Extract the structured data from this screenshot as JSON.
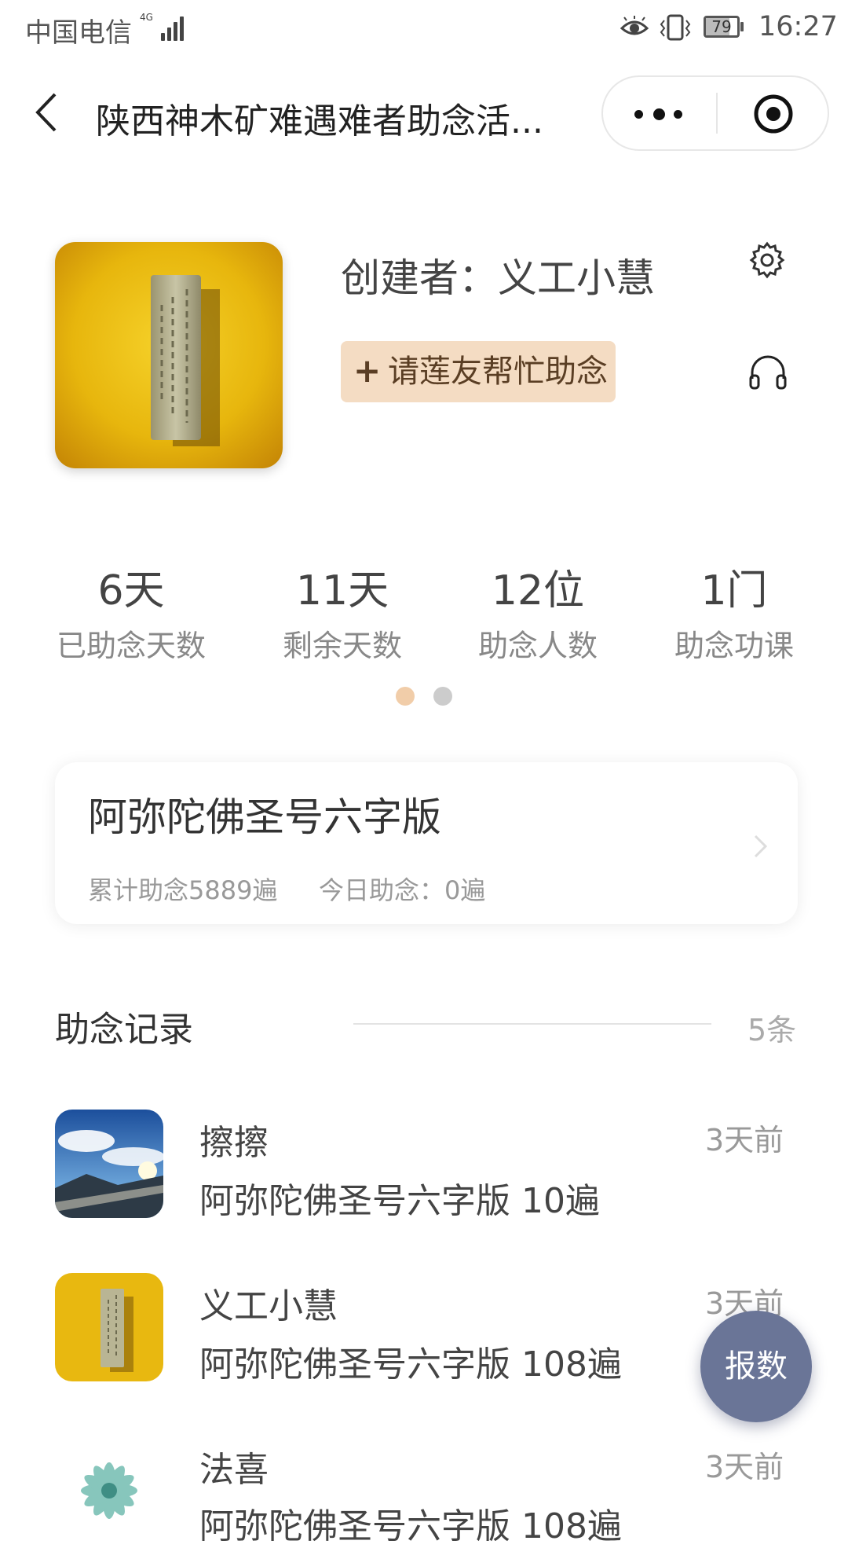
{
  "status_bar": {
    "carrier": "中国电信",
    "network": "4G",
    "battery": "79",
    "time": "16:27"
  },
  "nav": {
    "title": "陕西神木矿难遇难者助念活..."
  },
  "header": {
    "creator": "创建者：义工小慧",
    "invite_button": "请莲友帮忙助念",
    "invite_icon": "+"
  },
  "stats": [
    {
      "value": "6天",
      "label": "已助念天数"
    },
    {
      "value": "11天",
      "label": "剩余天数"
    },
    {
      "value": "12位",
      "label": "助念人数"
    },
    {
      "value": "1门",
      "label": "助念功课"
    }
  ],
  "pager": {
    "active_color": "#f1cda9",
    "inactive_color": "#cccccc"
  },
  "course": {
    "title": "阿弥陀佛圣号六字版",
    "total": "累计助念5889遍",
    "today": "今日助念：0遍"
  },
  "records": {
    "title": "助念记录",
    "count": "5条",
    "items": [
      {
        "name": "擦擦",
        "detail": "阿弥陀佛圣号六字版 10遍",
        "time": "3天前",
        "avatar": "landscape-avatar"
      },
      {
        "name": "义工小慧",
        "detail": "阿弥陀佛圣号六字版 108遍",
        "time": "3天前",
        "avatar": "plaque-avatar"
      },
      {
        "name": "法喜",
        "detail": "阿弥陀佛圣号六字版 108遍",
        "time": "3天前",
        "avatar": "lotus-avatar"
      }
    ]
  },
  "fab": {
    "label": "报数"
  },
  "colors": {
    "accent": "#6a7597",
    "invite_bg": "#f4dcc3"
  }
}
